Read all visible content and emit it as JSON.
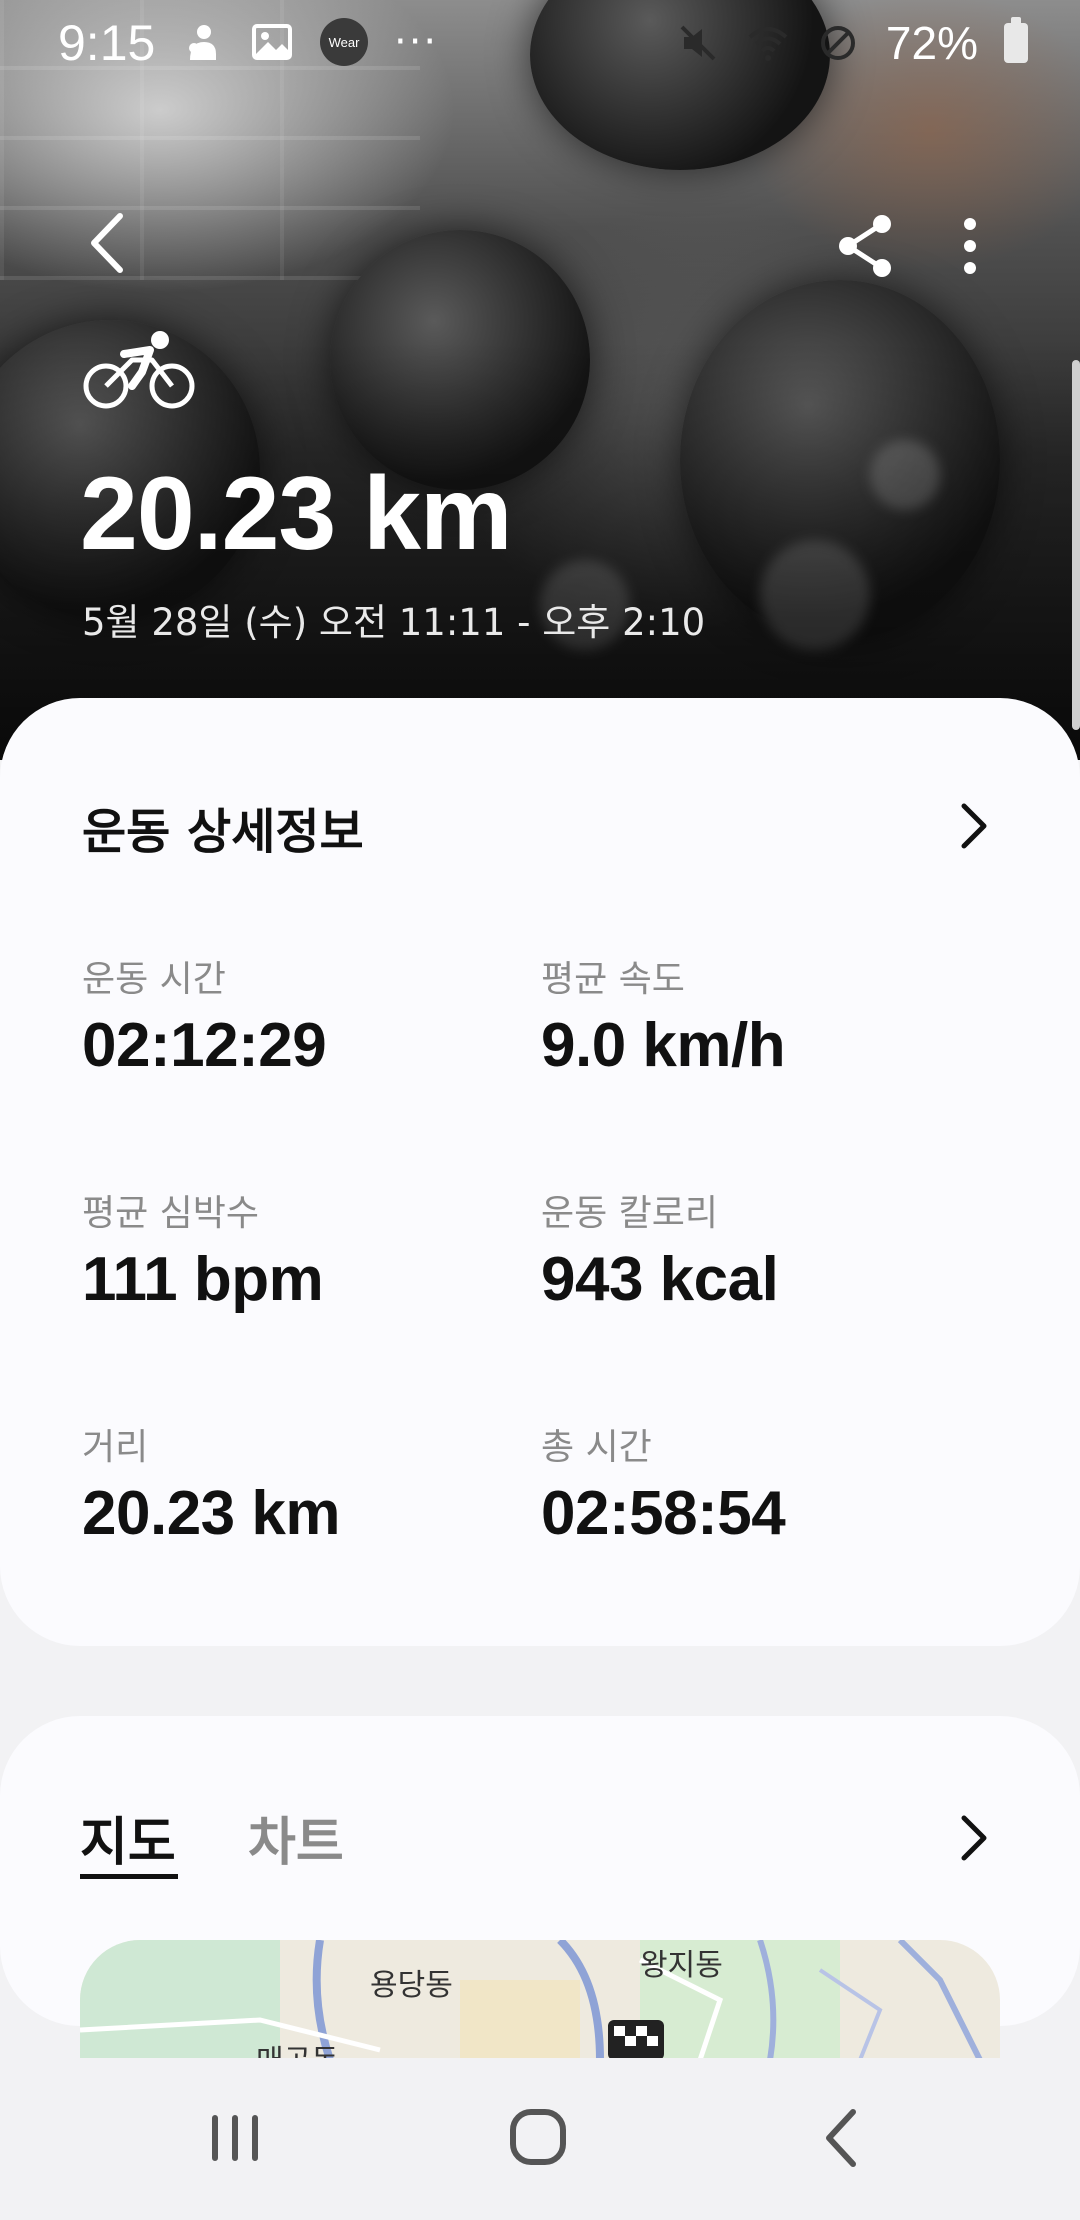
{
  "status_bar": {
    "time": "9:15",
    "wear_label": "Wear",
    "overflow": "···",
    "battery": "72%"
  },
  "header": {
    "activity_icon": "cycling-icon",
    "distance": "20.23 km",
    "date_range": "5월 28일 (수) 오전 11:11 - 오후 2:10"
  },
  "details": {
    "title": "운동 상세정보",
    "stats": [
      {
        "label": "운동 시간",
        "value": "02:12:29"
      },
      {
        "label": "평균 속도",
        "value": "9.0 km/h"
      },
      {
        "label": "평균 심박수",
        "value": "111 bpm"
      },
      {
        "label": "운동 칼로리",
        "value": "943 kcal"
      },
      {
        "label": "거리",
        "value": "20.23 km"
      },
      {
        "label": "총 시간",
        "value": "02:58:54"
      }
    ]
  },
  "map_section": {
    "tabs": [
      {
        "label": "지도",
        "active": true
      },
      {
        "label": "차트",
        "active": false
      }
    ],
    "place_labels": [
      "용당동",
      "왕지동",
      "매곡동"
    ]
  },
  "colors": {
    "card_bg": "#fbfbfe",
    "page_bg": "#f2f2f4",
    "primary_text": "#111111",
    "secondary_text": "#8a8a8a"
  }
}
